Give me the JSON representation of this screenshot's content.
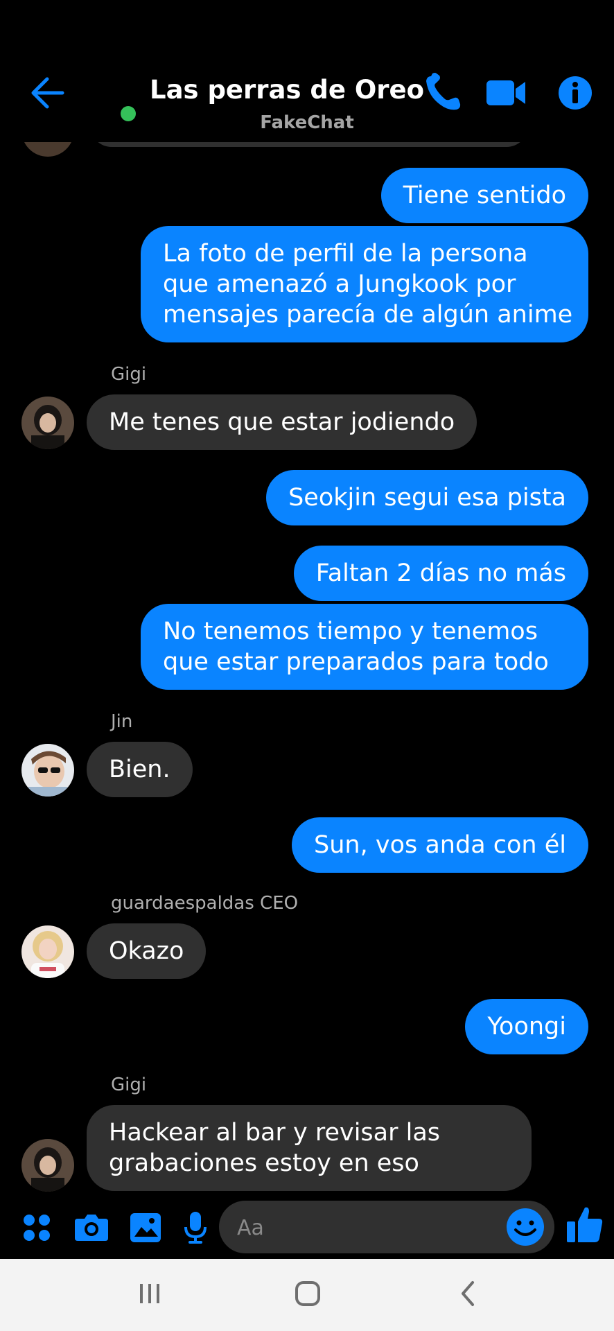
{
  "header": {
    "title": "Las perras de Oreo",
    "subtitle": "FakeChat",
    "back_icon": "back-arrow-icon",
    "call_icon": "phone-icon",
    "video_icon": "video-camera-icon",
    "info_icon": "info-icon",
    "accent": "#0a84ff",
    "online_color": "#35c15a"
  },
  "messages": [
    {
      "dir": "out",
      "text": "Tiene sentido"
    },
    {
      "dir": "out",
      "lines": [
        "La foto de perfil de la persona",
        "que amenazó a Jungkook por",
        "mensajes parecía de algún anime"
      ]
    },
    {
      "dir": "in",
      "sender": "Gigi",
      "text": "Me tenes que estar jodiendo"
    },
    {
      "dir": "out",
      "text": "Seokjin segui esa pista"
    },
    {
      "dir": "out",
      "text": "Faltan 2 días no más"
    },
    {
      "dir": "out",
      "lines": [
        "No tenemos tiempo y tenemos",
        "que estar preparados para todo"
      ]
    },
    {
      "dir": "in",
      "sender": "Jin",
      "text": "Bien."
    },
    {
      "dir": "out",
      "text": "Sun, vos anda con él"
    },
    {
      "dir": "in",
      "sender": "guardaespaldas CEO",
      "text": "Okazo"
    },
    {
      "dir": "out",
      "text": "Yoongi"
    },
    {
      "dir": "in",
      "sender": "Gigi",
      "lines": [
        "Hackear al bar y revisar las",
        "grabaciones estoy en eso"
      ]
    }
  ],
  "composer": {
    "placeholder": "Aa",
    "icons": [
      "apps-icon",
      "camera-icon",
      "image-icon",
      "microphone-icon",
      "emoji-icon",
      "thumbs-up-icon"
    ]
  },
  "colors": {
    "outgoing_bubble": "#0a84ff",
    "incoming_bubble": "#303030",
    "background": "#000000"
  },
  "navbar": {
    "icons": [
      "recent-apps-icon",
      "home-icon",
      "back-icon"
    ]
  }
}
